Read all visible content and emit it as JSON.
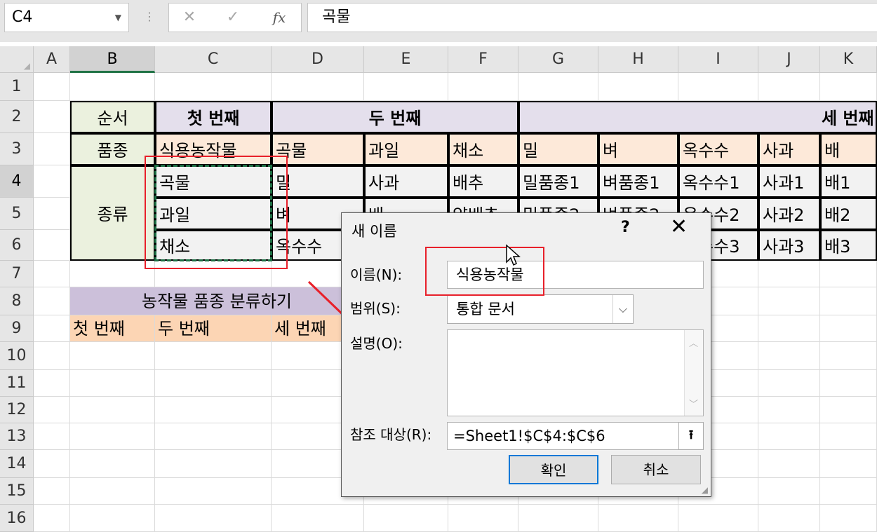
{
  "formula_bar": {
    "name_box": "C4",
    "cancel_icon": "✕",
    "enter_icon": "✓",
    "function_icon": "fx",
    "formula": "곡물"
  },
  "columns": [
    "A",
    "B",
    "C",
    "D",
    "E",
    "F",
    "G",
    "H",
    "I",
    "J",
    "K"
  ],
  "rows": [
    "1",
    "2",
    "3",
    "4",
    "5",
    "6",
    "7",
    "8",
    "9",
    "10",
    "11",
    "12",
    "13",
    "14",
    "15",
    "16"
  ],
  "cells": {
    "B2": "순서",
    "C2": "첫 번째",
    "D2": "두 번째",
    "G2": "세 번째",
    "B3": "품종",
    "C3": "식용농작물",
    "D3": "곡물",
    "E3": "과일",
    "F3": "채소",
    "G3": "밀",
    "H3": "벼",
    "I3": "옥수수",
    "J3": "사과",
    "K3": "배",
    "B4": "종류",
    "C4": "곡물",
    "D4": "밀",
    "E4": "사과",
    "F4": "배추",
    "G4": "밀품종1",
    "H4": "벼품종1",
    "I4": "옥수수1",
    "J4": "사과1",
    "K4": "배1",
    "C5": "과일",
    "D5": "벼",
    "E5": "배",
    "F5": "양배추",
    "G5": "밀품종2",
    "H5": "벼품종2",
    "I5": "옥수수2",
    "J5": "사과2",
    "K5": "배2",
    "C6": "채소",
    "D6": "옥수수",
    "I6": "옥수수3",
    "J6": "사과3",
    "K6": "배3",
    "B8": "농작물 품종 분류하기",
    "B9": "첫 번째",
    "C9": "두 번째",
    "D9": "세 번째"
  },
  "dialog": {
    "title": "새 이름",
    "help_icon": "?",
    "close_icon": "✕",
    "name_label": "이름(N):",
    "name_value": "식용농작물",
    "scope_label": "범위(S):",
    "scope_value": "통합 문서",
    "comment_label": "설명(O):",
    "comment_value": "",
    "refers_label": "참조 대상(R):",
    "refers_value": "=Sheet1!$C$4:$C$6",
    "ok_label": "확인",
    "cancel_label": "취소"
  },
  "colors": {
    "header_green": "#ebf1de",
    "header_purple": "#e4dfec",
    "variety_peach": "#fde9d9",
    "data_gray": "#f2f2f2",
    "title_purple": "#ccc0da",
    "label_orange": "#fcd5b4",
    "annotation_red": "#e8202a",
    "excel_green": "#217346"
  }
}
